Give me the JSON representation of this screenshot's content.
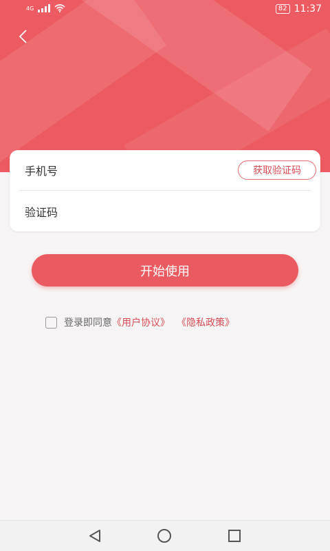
{
  "status_bar": {
    "network_label": "4G",
    "battery": "82",
    "time": "11:37"
  },
  "colors": {
    "brand": "#ea5b61",
    "link": "#d84d55"
  },
  "header": {
    "back_icon": "chevron-left-icon"
  },
  "form": {
    "phone_placeholder": "手机号",
    "get_code_label": "获取验证码",
    "code_placeholder": "验证码"
  },
  "start_button_label": "开始使用",
  "agreement": {
    "prefix": "登录即同意",
    "user_agreement": "《用户协议》",
    "privacy_policy": "《隐私政策》"
  },
  "nav_bar": {
    "back_icon": "triangle-back-icon",
    "home_icon": "circle-home-icon",
    "recent_icon": "square-recents-icon"
  }
}
